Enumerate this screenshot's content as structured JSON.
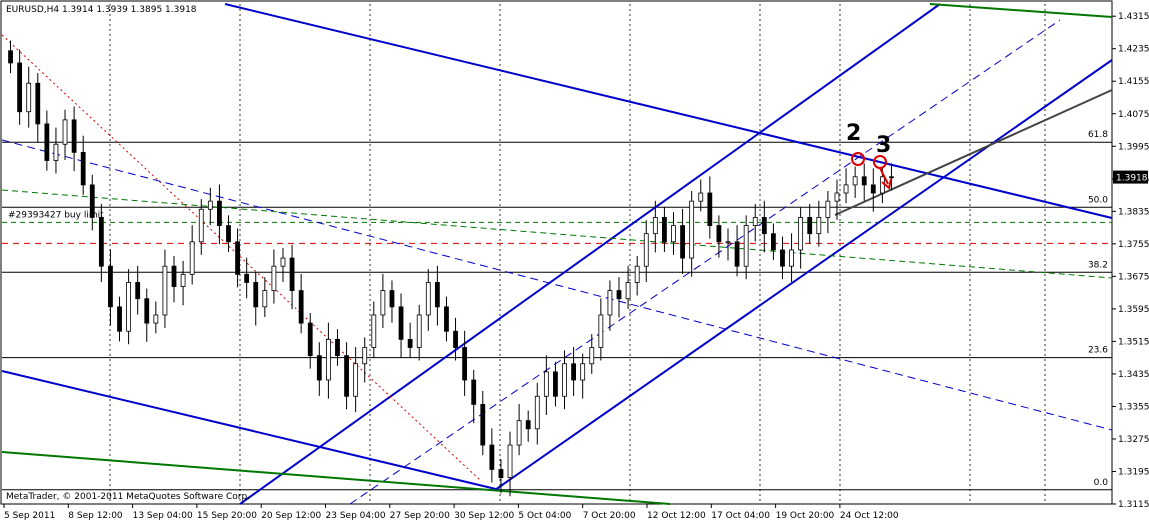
{
  "header": {
    "symbol_line": "EURUSD,H4  1.3914 1.3939 1.3895 1.3918"
  },
  "footer": {
    "copyright": "MetaTrader, © 2001-2011 MetaQuotes Software Corp."
  },
  "chart_data": {
    "type": "candlestick",
    "symbol": "EURUSD",
    "timeframe": "H4",
    "ohlc_last": {
      "open": 1.3914,
      "high": 1.3939,
      "low": 1.3895,
      "close": 1.3918
    },
    "current_price": "1.3918",
    "ylim": [
      1.3115,
      1.4345
    ],
    "y_ticks": [
      "1.4315",
      "1.4235",
      "1.4155",
      "1.4075",
      "1.3995",
      "1.3915",
      "1.3835",
      "1.3755",
      "1.3675",
      "1.3595",
      "1.3515",
      "1.3435",
      "1.3355",
      "1.3275",
      "1.3195",
      "1.3115"
    ],
    "x_ticks": [
      "5 Sep 2011",
      "8 Sep 12:00",
      "13 Sep 04:00",
      "15 Sep 20:00",
      "20 Sep 12:00",
      "23 Sep 04:00",
      "27 Sep 20:00",
      "30 Sep 12:00",
      "5 Oct 04:00",
      "7 Oct 20:00",
      "12 Oct 12:00",
      "17 Oct 04:00",
      "19 Oct 20:00",
      "24 Oct 12:00"
    ],
    "fib_levels": [
      {
        "label": "61.8",
        "price": 1.4005
      },
      {
        "label": "50.0",
        "price": 1.3845
      },
      {
        "label": "38.2",
        "price": 1.3685
      },
      {
        "label": "23.6",
        "price": 1.3475
      },
      {
        "label": "0.0",
        "price": 1.315
      }
    ],
    "order_line": {
      "label": "#29393427 buy limit",
      "price": 1.383
    },
    "annotations": [
      "2",
      "3"
    ],
    "colors": {
      "channel": "#0000cc",
      "trend_green": "#007700",
      "candle": "#000000",
      "dashed_red": "#dd0000",
      "annotation": "#dd0000"
    },
    "close": [
      1.42,
      1.408,
      1.415,
      1.405,
      1.396,
      1.4,
      1.406,
      1.398,
      1.39,
      1.382,
      1.37,
      1.36,
      1.354,
      1.366,
      1.362,
      1.356,
      1.358,
      1.37,
      1.365,
      1.368,
      1.376,
      1.384,
      1.386,
      1.38,
      1.376,
      1.368,
      1.366,
      1.36,
      1.364,
      1.37,
      1.372,
      1.364,
      1.356,
      1.348,
      1.342,
      1.352,
      1.348,
      1.338,
      1.346,
      1.35,
      1.358,
      1.364,
      1.36,
      1.352,
      1.35,
      1.358,
      1.366,
      1.36,
      1.354,
      1.35,
      1.342,
      1.336,
      1.326,
      1.32,
      1.318,
      1.326,
      1.332,
      1.33,
      1.338,
      1.344,
      1.338,
      1.346,
      1.342,
      1.346,
      1.35,
      1.358,
      1.364,
      1.362,
      1.366,
      1.37,
      1.378,
      1.382,
      1.376,
      1.38,
      1.372,
      1.386,
      1.388,
      1.38,
      1.376,
      1.376,
      1.37,
      1.38,
      1.382,
      1.378,
      1.374,
      1.37,
      1.374,
      1.382,
      1.378,
      1.382,
      1.386,
      1.388,
      1.39,
      1.392,
      1.39,
      1.388,
      1.392,
      1.3918
    ]
  }
}
